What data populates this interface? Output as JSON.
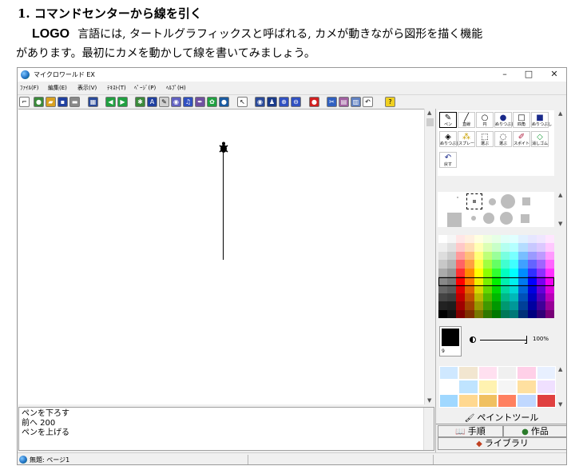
{
  "document": {
    "heading": "1. コマンドセンターから線を引く",
    "line1_logo": "LOGO",
    "line1_rest": "言語には, タートルグラフィックスと呼ばれる, カメが動きながら図形を描く機能",
    "line2": "があります。最初にカメを動かして線を書いてみましょう。"
  },
  "window": {
    "title": "マイクロワールド EX",
    "min_glyph": "–",
    "max_glyph": "□",
    "close_glyph": "✕"
  },
  "menubar": {
    "items": [
      "ﾌｧｲﾙ(F)",
      "編集(E)",
      "表示(V)",
      "ﾃｷｽﾄ(T)",
      "ﾍﾟｰｼﾞ(P)",
      "ﾍﾙﾌﾟ(H)"
    ]
  },
  "toolbar": {
    "icons": [
      "cursor-icon",
      "new-icon",
      "open-icon",
      "save-icon",
      "print-icon",
      "layout-icon",
      "back-icon",
      "forward-icon",
      "turtle-icon",
      "textbox-icon",
      "pencil-icon",
      "eye-icon",
      "music-icon",
      "brush-icon",
      "shape-icon",
      "globe-icon",
      "pointer-icon",
      "view-icon",
      "stamp-icon",
      "zoom-in-icon",
      "zoom-out-icon",
      "stop-icon",
      "cut-icon",
      "copy-icon",
      "paste-icon",
      "undo-icon",
      "help-icon"
    ]
  },
  "command_center": {
    "lines": [
      "ペンを下ろす",
      "前へ  200",
      "ペンを上げる"
    ]
  },
  "statusbar": {
    "text": "無題: ページ1"
  },
  "paint_tools": {
    "row1": [
      {
        "icon": "pen-icon",
        "label": "ペン"
      },
      {
        "icon": "line-icon",
        "label": "直線"
      },
      {
        "icon": "circle-icon",
        "label": "円"
      },
      {
        "icon": "filled-circle-icon",
        "label": "ぬりつぶし"
      },
      {
        "icon": "rectangle-icon",
        "label": "四角"
      },
      {
        "icon": "filled-rectangle-icon",
        "label": "ぬりつぶし"
      }
    ],
    "row2": [
      {
        "icon": "bucket-icon",
        "label": "ぬりつぶし"
      },
      {
        "icon": "spray-icon",
        "label": "スプレー"
      },
      {
        "icon": "select-rect-icon",
        "label": "選ぶ"
      },
      {
        "icon": "lasso-icon",
        "label": "選ぶ"
      },
      {
        "icon": "eyedropper-icon",
        "label": "スポイト"
      },
      {
        "icon": "eraser-icon",
        "label": "消しゴム"
      }
    ],
    "row3": [
      {
        "icon": "undo-icon",
        "label": "戻す"
      }
    ]
  },
  "current_color": {
    "number": "9",
    "value": "#000000"
  },
  "opacity": {
    "value": "100%",
    "fraction": 1.0,
    "end_glyph": "J"
  },
  "tabs": {
    "paint_tool": "ペイントツール",
    "procedures": "手順",
    "works": "作品",
    "library": "ライブラリ"
  },
  "colors": {
    "palette": [
      [
        "#ffffff",
        "#f6f6f6",
        "#ffe6e6",
        "#fff0e0",
        "#ffffe0",
        "#f0ffe0",
        "#e6ffe6",
        "#e0fff8",
        "#e0ffff",
        "#e0f0ff",
        "#e6e6ff",
        "#f0e6ff",
        "#ffe6ff"
      ],
      [
        "#eeeeee",
        "#e0e0e0",
        "#ffc8c8",
        "#ffdcb4",
        "#ffffb4",
        "#dcffb4",
        "#c8ffc8",
        "#b4fff0",
        "#b4ffff",
        "#b4dcff",
        "#c8c8ff",
        "#dcc8ff",
        "#ffc8ff"
      ],
      [
        "#dddddd",
        "#cccccc",
        "#ff9a9a",
        "#ffbe78",
        "#ffff78",
        "#beff78",
        "#9aff9a",
        "#78ffe0",
        "#78ffff",
        "#78beff",
        "#9a9aff",
        "#be9aff",
        "#ff9aff"
      ],
      [
        "#c8c8c8",
        "#b4b4b4",
        "#ff6464",
        "#ffa040",
        "#ffff40",
        "#a0ff40",
        "#64ff64",
        "#40ffd0",
        "#40ffff",
        "#40a0ff",
        "#6464ff",
        "#a064ff",
        "#ff64ff"
      ],
      [
        "#aaaaaa",
        "#969696",
        "#ff3030",
        "#ff8c00",
        "#ffff00",
        "#8cff00",
        "#30ff30",
        "#00ffc0",
        "#00ffff",
        "#008cff",
        "#3030ff",
        "#8c30ff",
        "#ff30ff"
      ],
      [
        "#888888",
        "#787878",
        "#ff0000",
        "#ff7800",
        "#f0f000",
        "#78f000",
        "#00f000",
        "#00f0b0",
        "#00f0f0",
        "#0078f0",
        "#0000ff",
        "#7800f0",
        "#f000f0"
      ],
      [
        "#666666",
        "#5a5a5a",
        "#e00000",
        "#e06400",
        "#d8d800",
        "#64d800",
        "#00d800",
        "#00d8a0",
        "#00d8d8",
        "#0064d8",
        "#0000e0",
        "#6400d8",
        "#d800d8"
      ],
      [
        "#444444",
        "#3c3c3c",
        "#c00000",
        "#c05000",
        "#b8b800",
        "#50b800",
        "#00b800",
        "#00b888",
        "#00b8b8",
        "#0050b8",
        "#0000c0",
        "#5000b8",
        "#b800b8"
      ],
      [
        "#222222",
        "#1e1e1e",
        "#a00000",
        "#a04000",
        "#989800",
        "#409800",
        "#009800",
        "#009870",
        "#009898",
        "#004098",
        "#0000a0",
        "#400098",
        "#980098"
      ],
      [
        "#000000",
        "#111111",
        "#800000",
        "#803000",
        "#787800",
        "#307800",
        "#007800",
        "#007858",
        "#007878",
        "#003078",
        "#000080",
        "#300078",
        "#780078"
      ]
    ],
    "patterns": [
      "#cfe8ff",
      "#f2e6d0",
      "#ffe0f0",
      "#f0f0f0",
      "#ffd0e8",
      "#e8f0ff",
      "#ffffff",
      "#bfe4ff",
      "#fff2b0",
      "#f5f5f5",
      "#ffe0a0",
      "#f0e0ff",
      "#a0d8ff",
      "#ffd890",
      "#f0c060",
      "#ff8060",
      "#c0d8ff",
      "#e04040"
    ]
  }
}
